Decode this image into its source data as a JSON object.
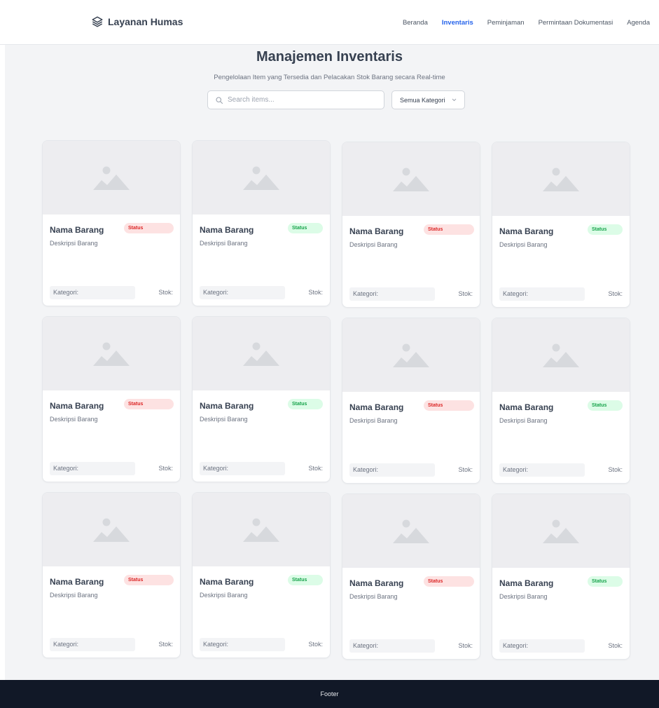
{
  "brand": {
    "name": "Layanan Humas",
    "icon": "layers-icon"
  },
  "nav": {
    "items": [
      {
        "label": "Beranda",
        "active": false
      },
      {
        "label": "Inventaris",
        "active": true
      },
      {
        "label": "Peminjaman",
        "active": false
      },
      {
        "label": "Permintaan Dokumentasi",
        "active": false
      },
      {
        "label": "Agenda",
        "active": false
      }
    ]
  },
  "hero": {
    "title": "Manajemen Inventaris",
    "subtitle": "Pengelolaan Item yang Tersedia dan Pelacakan Stok Barang secara Real-time"
  },
  "search": {
    "placeholder": "Search items...",
    "value": ""
  },
  "filter": {
    "selected": "Semua Kategori"
  },
  "colors": {
    "accent": "#2563eb",
    "status_red_bg": "#fde2e2",
    "status_red_text": "#dc2626",
    "status_green_bg": "#dcfce7",
    "status_green_text": "#16a34a",
    "footer_bg": "#111827"
  },
  "items": [
    {
      "name": "Nama Barang",
      "description": "Deskripsi Barang",
      "status": "Status",
      "status_color": "red",
      "category_label": "Kategori:",
      "stock_label": "Stok:"
    },
    {
      "name": "Nama Barang",
      "description": "Deskripsi Barang",
      "status": "Status",
      "status_color": "green",
      "category_label": "Kategori:",
      "stock_label": "Stok:"
    },
    {
      "name": "Nama Barang",
      "description": "Deskripsi Barang",
      "status": "Status",
      "status_color": "red",
      "category_label": "Kategori:",
      "stock_label": "Stok:"
    },
    {
      "name": "Nama Barang",
      "description": "Deskripsi Barang",
      "status": "Status",
      "status_color": "green",
      "category_label": "Kategori:",
      "stock_label": "Stok:"
    },
    {
      "name": "Nama Barang",
      "description": "Deskripsi Barang",
      "status": "Status",
      "status_color": "red",
      "category_label": "Kategori:",
      "stock_label": "Stok:"
    },
    {
      "name": "Nama Barang",
      "description": "Deskripsi Barang",
      "status": "Status",
      "status_color": "green",
      "category_label": "Kategori:",
      "stock_label": "Stok:"
    },
    {
      "name": "Nama Barang",
      "description": "Deskripsi Barang",
      "status": "Status",
      "status_color": "red",
      "category_label": "Kategori:",
      "stock_label": "Stok:"
    },
    {
      "name": "Nama Barang",
      "description": "Deskripsi Barang",
      "status": "Status",
      "status_color": "green",
      "category_label": "Kategori:",
      "stock_label": "Stok:"
    },
    {
      "name": "Nama Barang",
      "description": "Deskripsi Barang",
      "status": "Status",
      "status_color": "red",
      "category_label": "Kategori:",
      "stock_label": "Stok:"
    },
    {
      "name": "Nama Barang",
      "description": "Deskripsi Barang",
      "status": "Status",
      "status_color": "green",
      "category_label": "Kategori:",
      "stock_label": "Stok:"
    },
    {
      "name": "Nama Barang",
      "description": "Deskripsi Barang",
      "status": "Status",
      "status_color": "red",
      "category_label": "Kategori:",
      "stock_label": "Stok:"
    },
    {
      "name": "Nama Barang",
      "description": "Deskripsi Barang",
      "status": "Status",
      "status_color": "green",
      "category_label": "Kategori:",
      "stock_label": "Stok:"
    }
  ],
  "footer": {
    "text": "Footer"
  }
}
